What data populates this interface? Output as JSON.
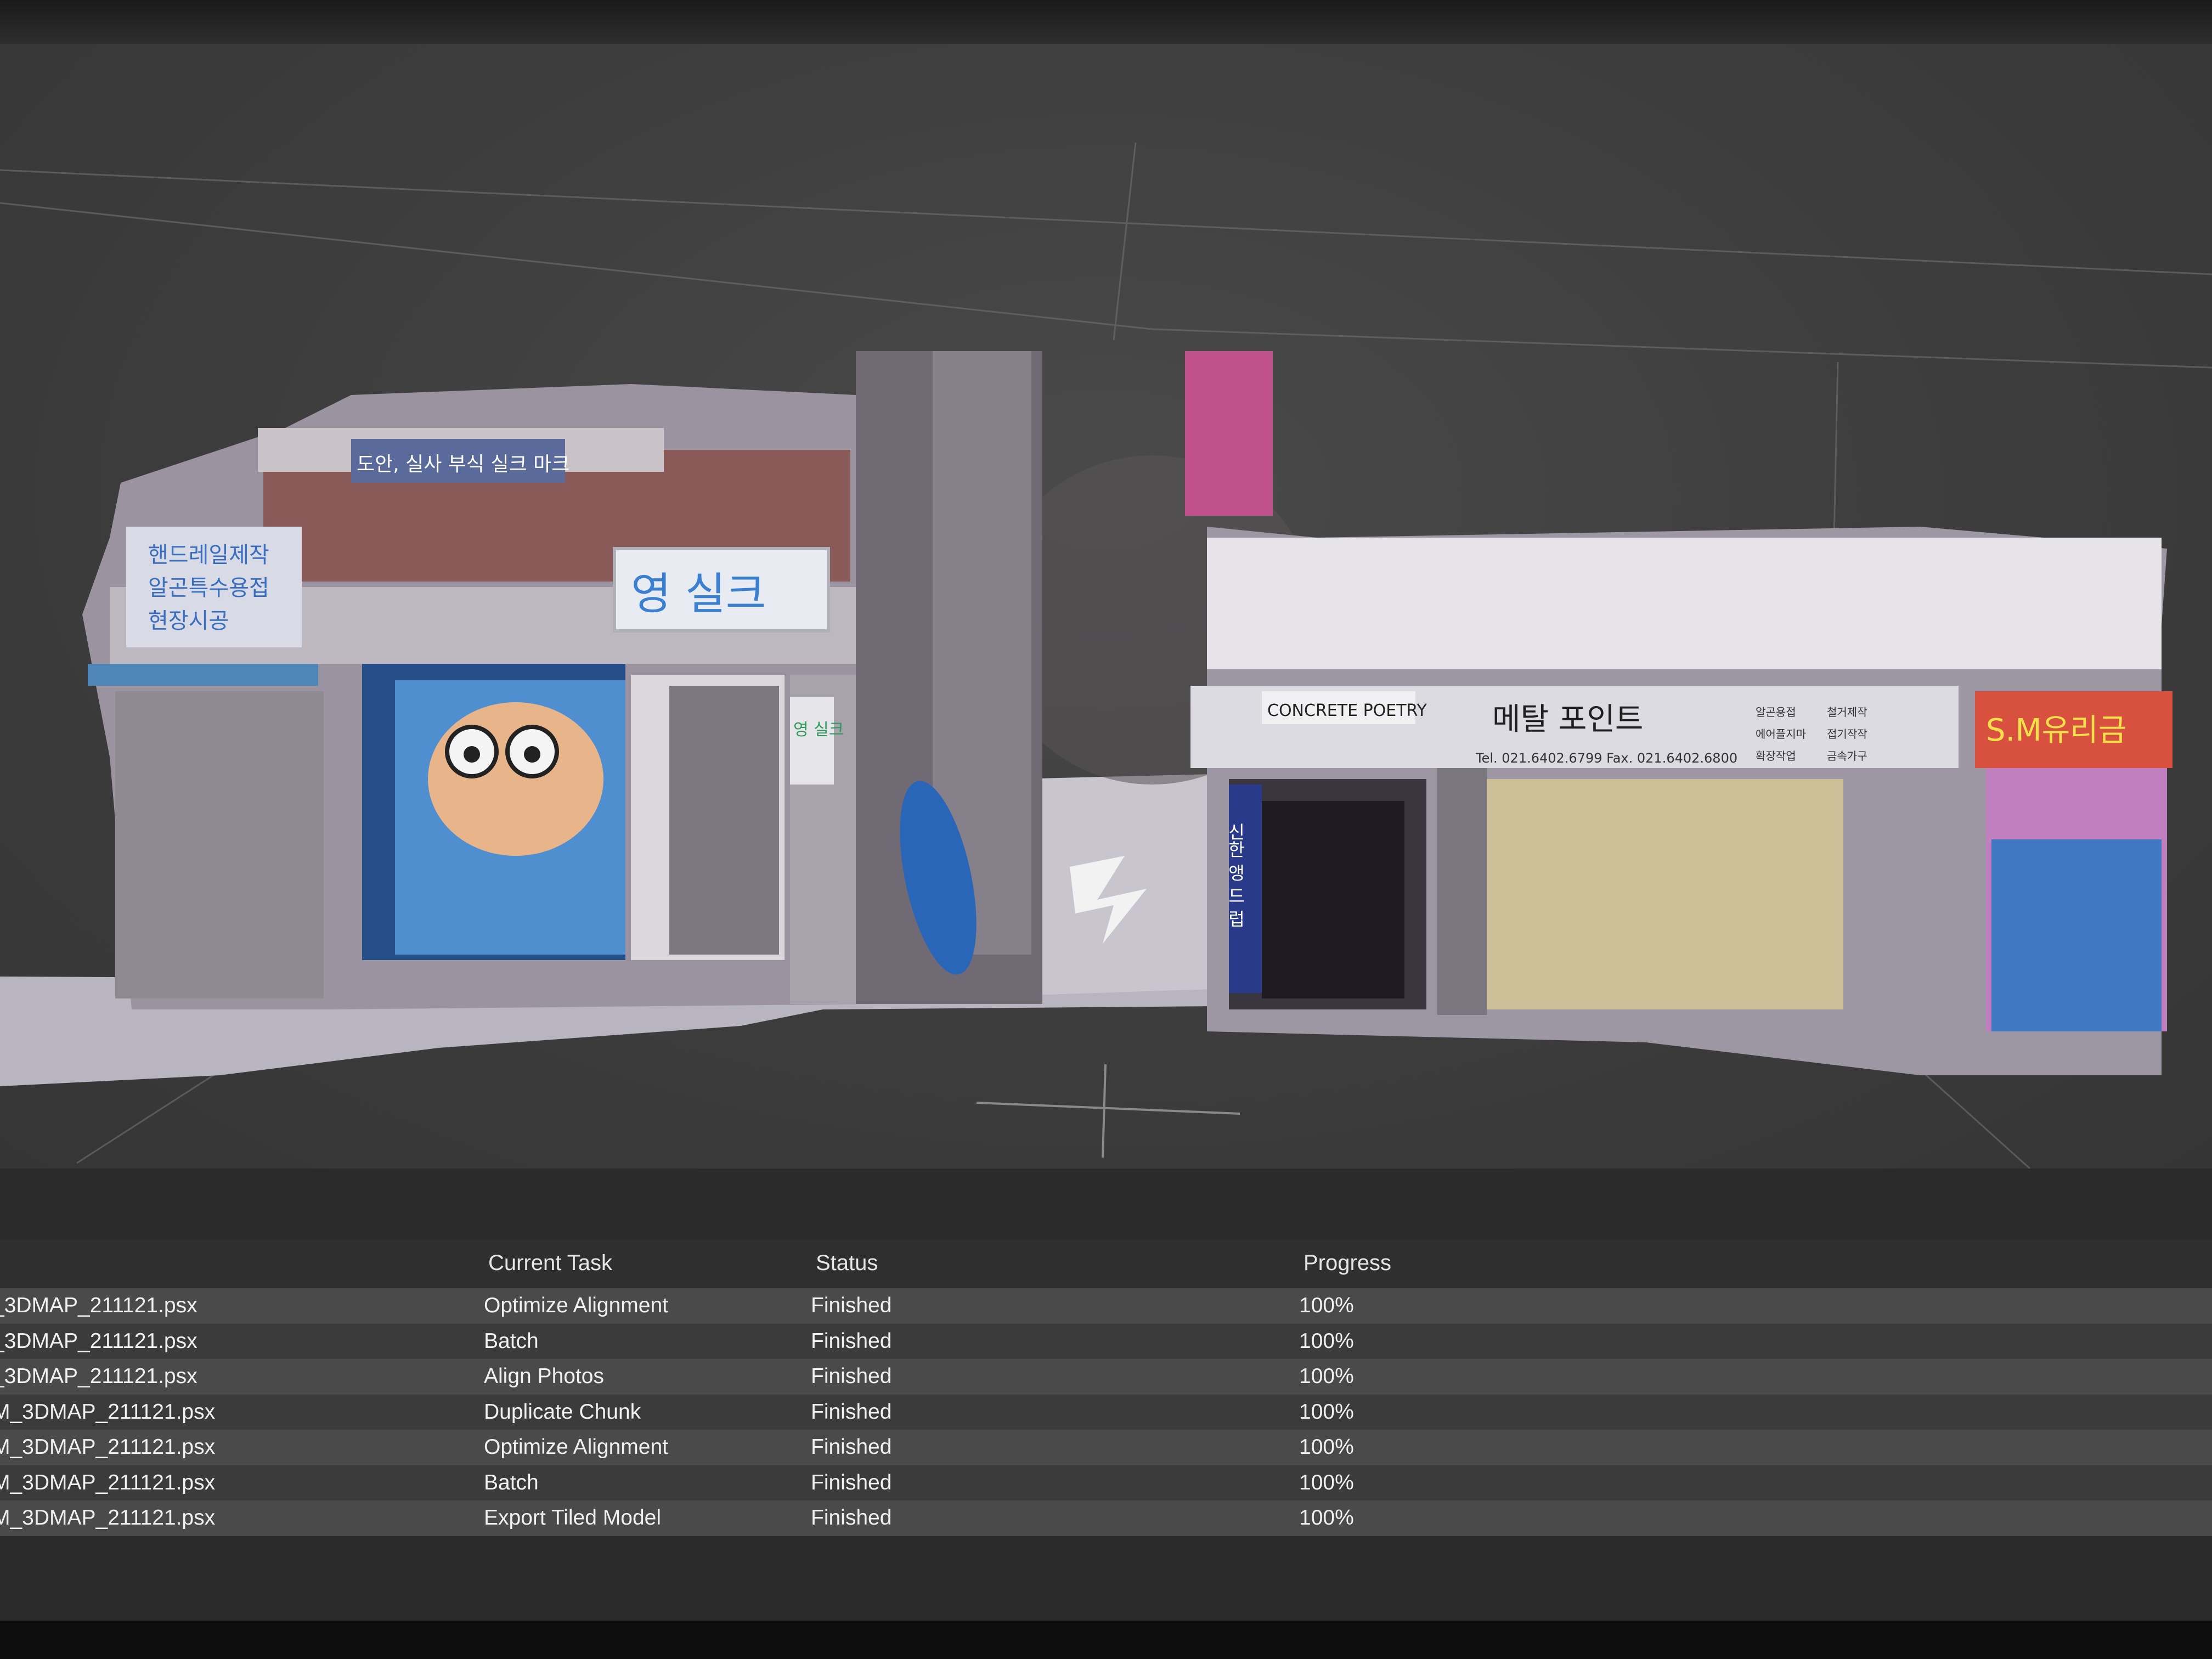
{
  "viewport": {
    "signs": {
      "left_wall_lines": [
        "핸드레일제작",
        "알곤특수용접",
        "현장시공"
      ],
      "top_banner": "도안, 실사 부식 실크 마크",
      "young_silk": "영 실크",
      "young_silk_vertical": "영 실크",
      "concrete_poetry": "CONCRETE POETRY",
      "metal_point": "메탈 포인트",
      "metal_point_phone": "Tel. 021.6402.6799    Fax. 021.6402.6800",
      "metal_point_services": [
        "알곤용접",
        "철거제작",
        "에어플지마",
        "접기작작",
        "확장작업",
        "금속가구"
      ],
      "right_sign": "S.M유리금",
      "vertical_blue": "신한 앵 드 럽"
    }
  },
  "jobs": {
    "headers": {
      "document": "",
      "current_task": "Current Task",
      "status": "Status",
      "progress": "Progress"
    },
    "rows": [
      {
        "document": "_3DMAP_211121.psx",
        "task": "Optimize Alignment",
        "status": "Finished",
        "progress": "100%"
      },
      {
        "document": "_3DMAP_211121.psx",
        "task": "Batch",
        "status": "Finished",
        "progress": "100%"
      },
      {
        "document": "_3DMAP_211121.psx",
        "task": "Align Photos",
        "status": "Finished",
        "progress": "100%"
      },
      {
        "document": "M_3DMAP_211121.psx",
        "task": "Duplicate Chunk",
        "status": "Finished",
        "progress": "100%"
      },
      {
        "document": "M_3DMAP_211121.psx",
        "task": "Optimize Alignment",
        "status": "Finished",
        "progress": "100%"
      },
      {
        "document": "M_3DMAP_211121.psx",
        "task": "Batch",
        "status": "Finished",
        "progress": "100%"
      },
      {
        "document": "M_3DMAP_211121.psx",
        "task": "Export Tiled Model",
        "status": "Finished",
        "progress": "100%"
      }
    ]
  },
  "colors": {
    "viewport_bg": "#3d3d3d",
    "panel_bg": "#2b2b2b",
    "row_light": "#4a4a4a",
    "row_dark": "#3b3b3b",
    "text": "#f0f0f0"
  }
}
